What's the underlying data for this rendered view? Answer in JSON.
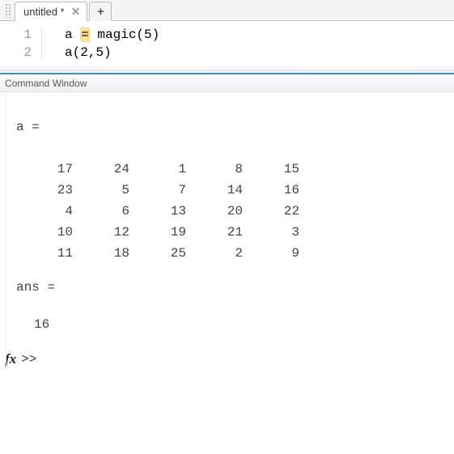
{
  "tabs": {
    "active_label": "untitled *",
    "close_glyph": "✕",
    "new_glyph": "+"
  },
  "editor": {
    "lines": [
      {
        "num": "1",
        "pre": "a ",
        "eq": "=",
        "post": " magic(5)"
      },
      {
        "num": "2",
        "pre": "a(2,5)",
        "eq": "",
        "post": ""
      }
    ]
  },
  "command_window": {
    "title": "Command Window",
    "var_header": "a =",
    "matrix": [
      [
        17,
        24,
        1,
        8,
        15
      ],
      [
        23,
        5,
        7,
        14,
        16
      ],
      [
        4,
        6,
        13,
        20,
        22
      ],
      [
        10,
        12,
        19,
        21,
        3
      ],
      [
        11,
        18,
        25,
        2,
        9
      ]
    ],
    "ans_header": "ans =",
    "ans_value": "16",
    "fx_label": "fx",
    "prompt": ">> "
  }
}
